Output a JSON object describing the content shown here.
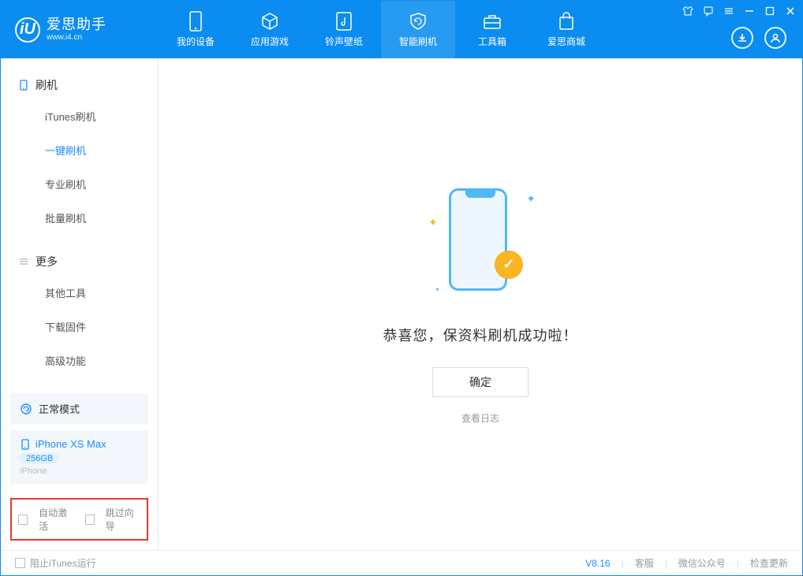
{
  "header": {
    "app_name": "爱思助手",
    "app_url": "www.i4.cn",
    "tabs": [
      {
        "label": "我的设备"
      },
      {
        "label": "应用游戏"
      },
      {
        "label": "铃声壁纸"
      },
      {
        "label": "智能刷机"
      },
      {
        "label": "工具箱"
      },
      {
        "label": "爱思商城"
      }
    ]
  },
  "sidebar": {
    "section1_title": "刷机",
    "items1": [
      {
        "label": "iTunes刷机"
      },
      {
        "label": "一键刷机"
      },
      {
        "label": "专业刷机"
      },
      {
        "label": "批量刷机"
      }
    ],
    "section2_title": "更多",
    "items2": [
      {
        "label": "其他工具"
      },
      {
        "label": "下载固件"
      },
      {
        "label": "高级功能"
      }
    ],
    "status_label": "正常模式",
    "device_name": "iPhone XS Max",
    "device_capacity": "256GB",
    "device_type": "iPhone",
    "check_auto_activate": "自动激活",
    "check_skip_wizard": "跳过向导"
  },
  "main": {
    "success_message": "恭喜您，保资料刷机成功啦！",
    "ok_button": "确定",
    "view_log": "查看日志"
  },
  "footer": {
    "block_itunes": "阻止iTunes运行",
    "version": "V8.16",
    "link_support": "客服",
    "link_wechat": "微信公众号",
    "link_update": "检查更新"
  },
  "colors": {
    "primary": "#0a8cf0",
    "accent": "#1a8cff",
    "badge": "#f9b522",
    "highlight_border": "#e53935"
  }
}
